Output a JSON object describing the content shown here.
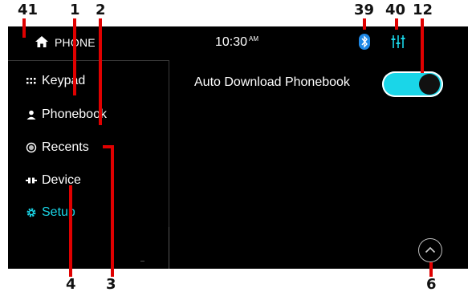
{
  "callouts": {
    "c41": "41",
    "c1": "1",
    "c2": "2",
    "c39": "39",
    "c40": "40",
    "c12": "12",
    "c4": "4",
    "c3": "3",
    "c6": "6"
  },
  "status": {
    "title": "PHONE",
    "time": "10:30",
    "ampm": "AM"
  },
  "sidebar": {
    "items": [
      {
        "label": "Keypad",
        "icon": "keypad-icon"
      },
      {
        "label": "Phonebook",
        "icon": "person-icon"
      },
      {
        "label": "Recents",
        "icon": "recents-icon"
      },
      {
        "label": "Device",
        "icon": "device-icon"
      },
      {
        "label": "Setup",
        "icon": "gear-icon",
        "active": true
      }
    ]
  },
  "main": {
    "auto_download_label": "Auto Download Phonebook",
    "auto_download_on": true
  },
  "colors": {
    "accent": "#1ad6e8",
    "bluetooth": "#1e88e5",
    "callout_line": "#e00000"
  }
}
